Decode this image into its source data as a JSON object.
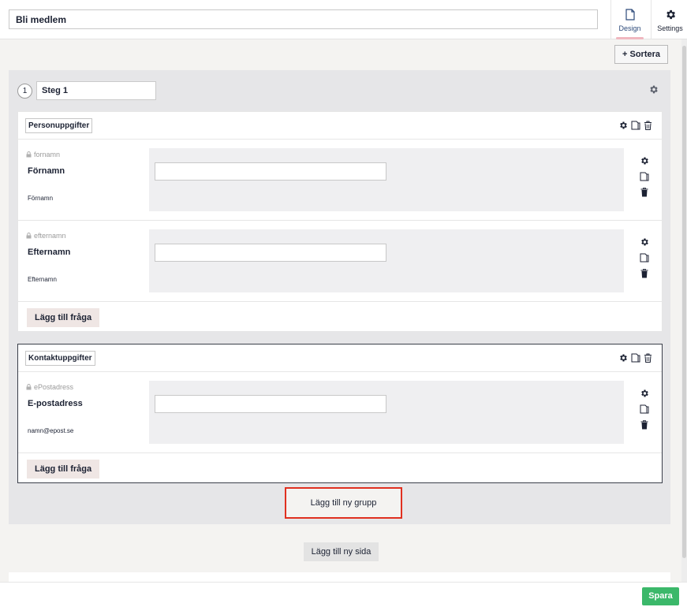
{
  "header": {
    "form_title": "Bli medlem",
    "tabs": [
      {
        "label": "Design",
        "icon": "document-icon",
        "active": true
      },
      {
        "label": "Settings",
        "icon": "gear-icon",
        "active": false
      }
    ]
  },
  "toolbar": {
    "sort_label": "+ Sortera"
  },
  "step": {
    "number": "1",
    "name": "Steg 1",
    "groups": [
      {
        "name": "Personuppgifter",
        "questions": [
          {
            "variable": "fornamn",
            "label": "Förnamn",
            "placeholder": "Förnamn"
          },
          {
            "variable": "efternamn",
            "label": "Efternamn",
            "placeholder": "Efternamn"
          }
        ],
        "add_question_label": "Lägg till fråga"
      },
      {
        "name": "Kontaktuppgifter",
        "questions": [
          {
            "variable": "ePostadress",
            "label": "E-postadress",
            "placeholder": "namn@epost.se"
          }
        ],
        "add_question_label": "Lägg till fråga"
      }
    ],
    "add_group_label": "Lägg till ny grupp"
  },
  "add_page_label": "Lägg till ny sida",
  "footer": {
    "save_label": "Spara"
  },
  "colors": {
    "save": "#3bb86a",
    "highlight": "#e03020",
    "active_tab": "#2d4a7a"
  }
}
